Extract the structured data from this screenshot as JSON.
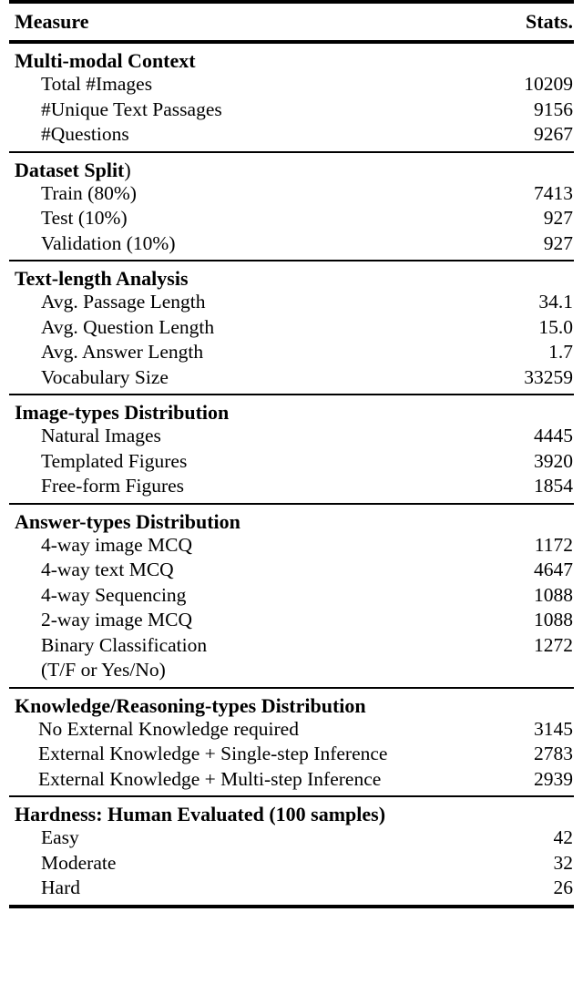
{
  "table": {
    "columns": [
      "Measure",
      "Stats."
    ],
    "sections": [
      {
        "heading": "Multi-modal Context",
        "heading_suffix": "",
        "rows": [
          {
            "label": "Total #Images",
            "value": "10209"
          },
          {
            "label": "#Unique Text Passages",
            "value": "9156"
          },
          {
            "label": "#Questions",
            "value": "9267"
          }
        ]
      },
      {
        "heading": "Dataset Split",
        "heading_suffix": ")",
        "rows": [
          {
            "label": "Train (80%)",
            "value": "7413"
          },
          {
            "label": "Test (10%)",
            "value": "927"
          },
          {
            "label": "Validation (10%)",
            "value": "927"
          }
        ]
      },
      {
        "heading": "Text-length Analysis",
        "heading_suffix": "",
        "rows": [
          {
            "label": "Avg. Passage Length",
            "value": "34.1"
          },
          {
            "label": "Avg. Question Length",
            "value": "15.0"
          },
          {
            "label": "Avg. Answer Length",
            "value": "1.7"
          },
          {
            "label": "Vocabulary Size",
            "value": "33259"
          }
        ]
      },
      {
        "heading": "Image-types Distribution",
        "heading_suffix": "",
        "rows": [
          {
            "label": "Natural Images",
            "value": "4445"
          },
          {
            "label": "Templated Figures",
            "value": "3920"
          },
          {
            "label": "Free-form Figures",
            "value": "1854"
          }
        ]
      },
      {
        "heading": "Answer-types Distribution",
        "heading_suffix": "",
        "rows": [
          {
            "label": "4-way image MCQ",
            "value": "1172"
          },
          {
            "label": "4-way text MCQ",
            "value": "4647"
          },
          {
            "label": "4-way Sequencing",
            "value": "1088"
          },
          {
            "label": "2-way image MCQ",
            "value": "1088"
          },
          {
            "label": "Binary Classification",
            "value": "1272"
          },
          {
            "label": "(T/F or Yes/No)",
            "value": ""
          }
        ]
      },
      {
        "heading": "Knowledge/Reasoning-types Distribution",
        "heading_suffix": "",
        "rows": [
          {
            "label": "No External Knowledge required",
            "value": "3145"
          },
          {
            "label": "External Knowledge + Single-step Inference",
            "value": "2783"
          },
          {
            "label": "External Knowledge + Multi-step Inference",
            "value": "2939"
          }
        ]
      },
      {
        "heading": "Hardness: Human Evaluated (100 samples)",
        "heading_suffix": "",
        "rows": [
          {
            "label": "Easy",
            "value": "42"
          },
          {
            "label": "Moderate",
            "value": "32"
          },
          {
            "label": "Hard",
            "value": "26"
          }
        ]
      }
    ]
  }
}
